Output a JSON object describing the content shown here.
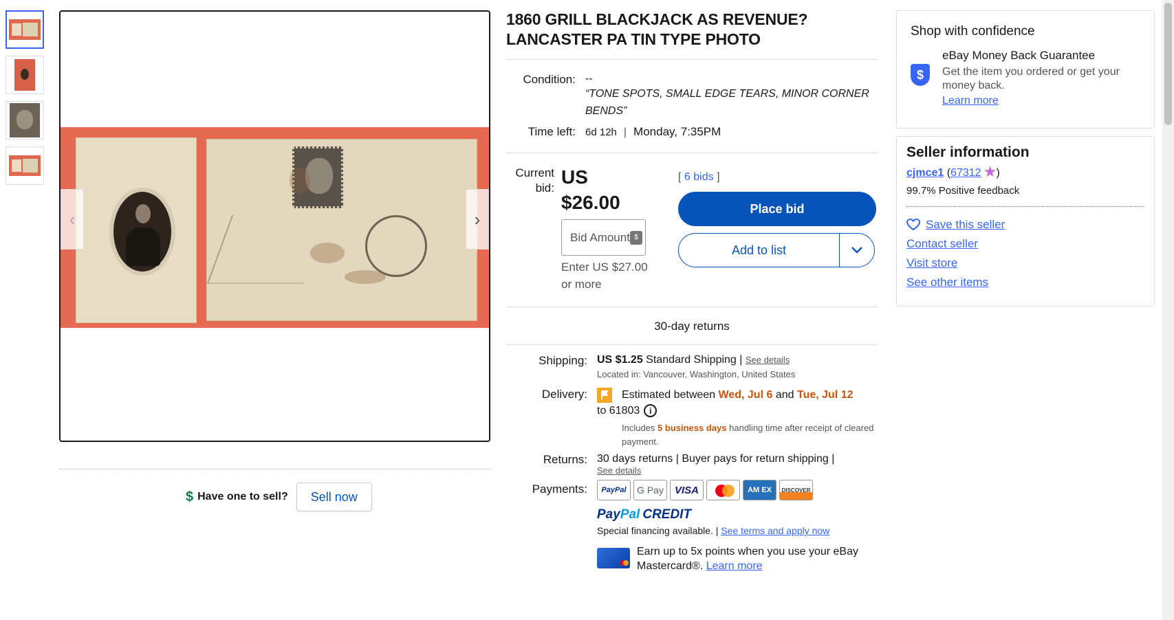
{
  "listing": {
    "title": "1860 GRILL BLACKJACK AS REVENUE? LANCASTER PA TIN TYPE PHOTO",
    "condition_label": "Condition:",
    "condition_value": "--",
    "condition_quote": "TONE SPOTS, SMALL EDGE TEARS, MINOR CORNER BENDS",
    "time_left_label": "Time left:",
    "time_left_value": "6d 12h",
    "time_left_end": "Monday, 7:35PM"
  },
  "gallery": {
    "prev_label": "‹",
    "next_label": "›"
  },
  "bid": {
    "label": "Current bid:",
    "currency": "US",
    "amount": "$26.00",
    "bids_open": "[",
    "bids_link": "6 bids",
    "bids_close": "]",
    "input_placeholder": "Bid Amount",
    "enter_hint": "Enter US $27.00 or more",
    "place_bid": "Place bid",
    "add_to_list": "Add to list"
  },
  "returns_banner": "30-day returns",
  "shipping": {
    "label": "Shipping:",
    "price": "US $1.25",
    "method": "Standard Shipping",
    "sep": "|",
    "see_details": "See details",
    "located": "Located in: Vancouver, Washington, United States"
  },
  "delivery": {
    "label": "Delivery:",
    "est_prefix": "Estimated between",
    "date1": "Wed, Jul 6",
    "and": "and",
    "date2": "Tue, Jul 12",
    "to_zip": "to 61803",
    "includes_prefix": "Includes",
    "business_days": "5 business days",
    "includes_suffix": "handling time after receipt of cleared payment."
  },
  "returns": {
    "label": "Returns:",
    "text": "30 days returns | Buyer pays for return shipping |",
    "see_details": "See details"
  },
  "payments": {
    "label": "Payments:",
    "logos": [
      "PayPal",
      "G Pay",
      "VISA",
      "",
      "AM EX",
      "DISCOVER"
    ],
    "pp_credit_1": "Pay",
    "pp_credit_2": "Pal",
    "pp_credit_3": "CREDIT",
    "financing": "Special financing available. |",
    "financing_link": "See terms and apply now",
    "mastercard_text": "Earn up to 5x points when you use your eBay Mastercard®.",
    "mastercard_link": "Learn more"
  },
  "sell": {
    "question": "Have one to sell?",
    "button": "Sell now"
  },
  "confidence": {
    "heading": "Shop with confidence",
    "guarantee_title": "eBay Money Back Guarantee",
    "guarantee_text": "Get the item you ordered or get your money back.",
    "learn_more": "Learn more"
  },
  "seller": {
    "heading": "Seller information",
    "name": "cjmce1",
    "score_open": "(",
    "score": "67312",
    "score_close": ")",
    "feedback": "99.7% Positive feedback",
    "save": "Save this seller",
    "contact": "Contact seller",
    "visit": "Visit store",
    "other": "See other items"
  },
  "colors": {
    "primary": "#0654ba",
    "link": "#3665f3",
    "accent_orange": "#c7550c",
    "money_green": "#05823f"
  }
}
